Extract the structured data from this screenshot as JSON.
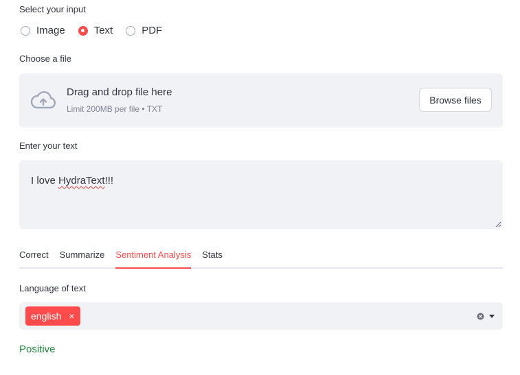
{
  "input_selector": {
    "label": "Select your input",
    "options": [
      {
        "label": "Image",
        "checked": false
      },
      {
        "label": "Text",
        "checked": true
      },
      {
        "label": "PDF",
        "checked": false
      }
    ]
  },
  "file_upload": {
    "label": "Choose a file",
    "title": "Drag and drop file here",
    "limit": "Limit 200MB per file • TXT",
    "button_label": "Browse files",
    "icon": "cloud-upload-icon"
  },
  "text_input": {
    "label": "Enter your text",
    "value_prefix": "I love ",
    "value_misspelled": "HydraText",
    "value_suffix": "!!!"
  },
  "tabs": [
    {
      "label": "Correct",
      "active": false
    },
    {
      "label": "Summarize",
      "active": false
    },
    {
      "label": "Sentiment Analysis",
      "active": true
    },
    {
      "label": "Stats",
      "active": false
    }
  ],
  "language": {
    "label": "Language of text",
    "selected_chip": "english",
    "chip_close": "×"
  },
  "result": {
    "text": "Positive",
    "color": "#21863d"
  },
  "colors": {
    "accent": "#ff4b4b",
    "panel": "#f0f2f6",
    "text": "#31333f"
  }
}
